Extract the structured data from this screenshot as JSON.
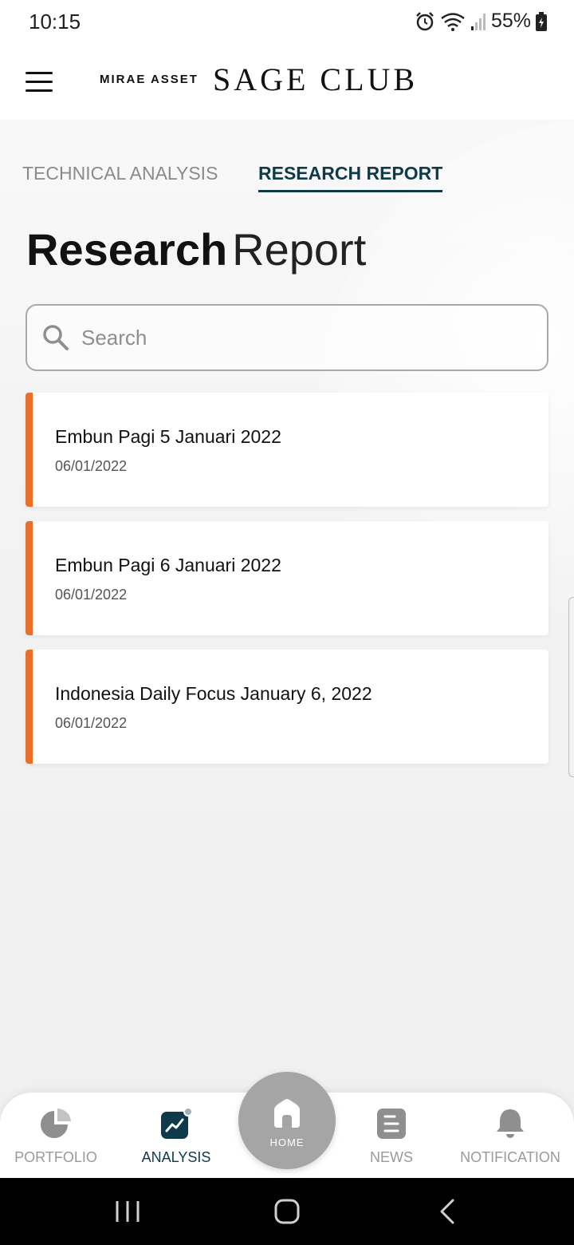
{
  "status_bar": {
    "time": "10:15",
    "battery": "55%",
    "icons": [
      "alarm-icon",
      "wifi-icon",
      "signal-icon",
      "battery-charging-icon"
    ]
  },
  "header": {
    "brand_small": "MIRAE ASSET",
    "brand_large": "SAGE CLUB",
    "menu_icon": "hamburger-menu-icon"
  },
  "tabs": [
    {
      "label": "TECHNICAL ANALYSIS",
      "active": false
    },
    {
      "label": "RESEARCH REPORT",
      "active": true
    }
  ],
  "page_title": {
    "bold": "Research",
    "light": "Report"
  },
  "search": {
    "placeholder": "Search",
    "value": ""
  },
  "reports": [
    {
      "title": "Embun Pagi 5 Januari 2022",
      "date": "06/01/2022"
    },
    {
      "title": "Embun Pagi 6 Januari 2022",
      "date": "06/01/2022"
    },
    {
      "title": "Indonesia Daily Focus January 6, 2022",
      "date": "06/01/2022"
    }
  ],
  "bottom_nav": {
    "portfolio": "PORTFOLIO",
    "analysis": "ANALYSIS",
    "home": "HOME",
    "news": "NEWS",
    "notification": "NOTIFICATION",
    "active": "ANALYSIS"
  },
  "colors": {
    "accent": "#e8702a",
    "primary": "#0f3a4a",
    "inactive": "#9a9a9a",
    "home_button": "#a5a5a5"
  }
}
